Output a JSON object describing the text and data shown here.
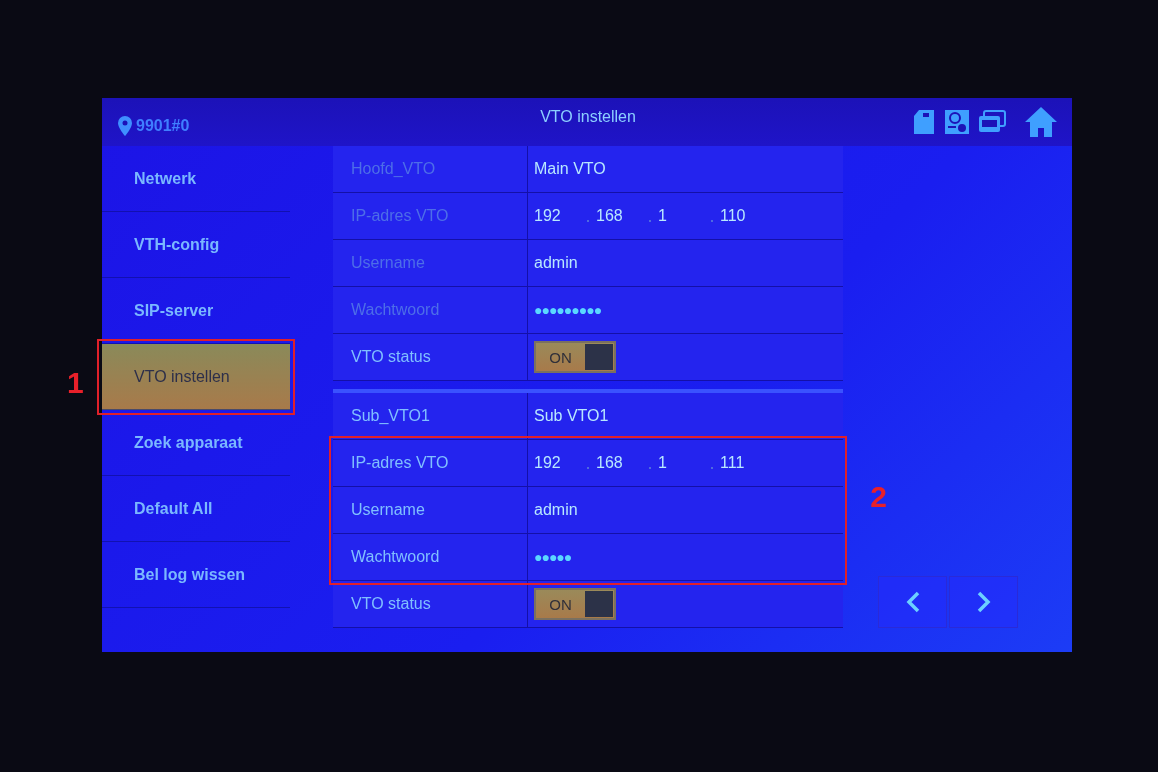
{
  "header": {
    "location": "9901#0",
    "title": "VTO instellen"
  },
  "sidebar": {
    "items": [
      {
        "label": "Netwerk",
        "selected": false
      },
      {
        "label": "VTH-config",
        "selected": false
      },
      {
        "label": "SIP-server",
        "selected": false
      },
      {
        "label": "VTO instellen",
        "selected": true,
        "callout": "1"
      },
      {
        "label": "Zoek apparaat",
        "selected": false
      },
      {
        "label": "Default All",
        "selected": false
      },
      {
        "label": "Bel log wissen",
        "selected": false
      }
    ]
  },
  "form": {
    "sections": [
      {
        "items": [
          {
            "kind": "text",
            "label": "Hoofd_VTO",
            "value": "Main VTO",
            "dimmed": true
          },
          {
            "kind": "ip",
            "label": "IP-adres VTO",
            "octets": [
              "192",
              "168",
              "1",
              "110"
            ],
            "dimmed": true
          },
          {
            "kind": "text",
            "label": "Username",
            "value": "admin",
            "dimmed": true
          },
          {
            "kind": "password",
            "label": "Wachtwoord",
            "value": "●●●●●●●●●",
            "dimmed": true
          },
          {
            "kind": "toggle",
            "label": "VTO status",
            "on": true,
            "state_label": "ON",
            "dimmed": false
          }
        ]
      },
      {
        "items": [
          {
            "kind": "text",
            "label": "Sub_VTO1",
            "value": "Sub VTO1",
            "dimmed": false
          },
          {
            "kind": "callout_group",
            "callout": "2",
            "rows": [
              {
                "kind": "ip",
                "label": "IP-adres VTO",
                "octets": [
                  "192",
                  "168",
                  "1",
                  "111"
                ],
                "dimmed": false
              },
              {
                "kind": "text",
                "label": "Username",
                "value": "admin",
                "dimmed": false
              },
              {
                "kind": "password",
                "label": "Wachtwoord",
                "value": "●●●●●",
                "dimmed": false
              }
            ]
          },
          {
            "kind": "toggle",
            "label": "VTO status",
            "on": true,
            "state_label": "ON",
            "dimmed": false
          }
        ]
      }
    ]
  }
}
